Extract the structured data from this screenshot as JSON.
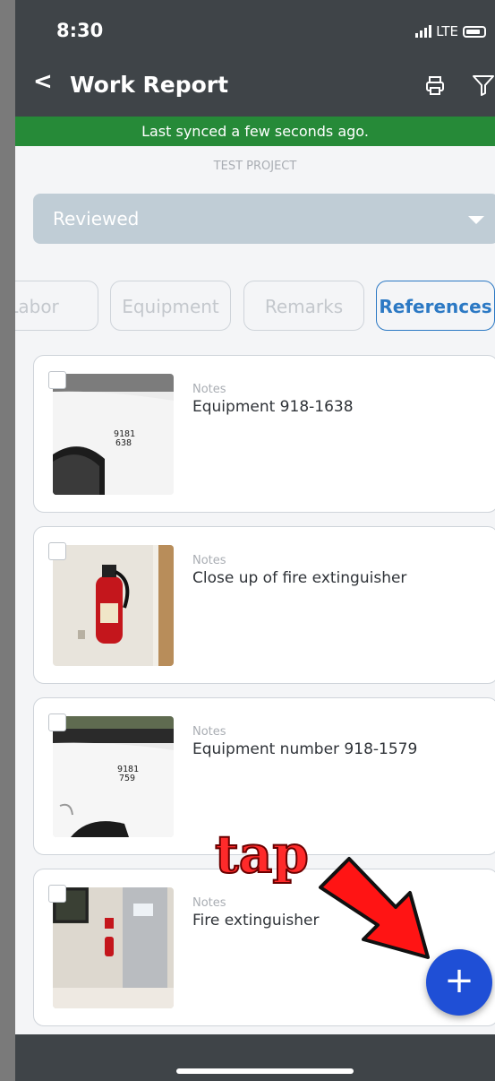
{
  "status_bar": {
    "time": "8:30",
    "network": "LTE"
  },
  "header": {
    "title": "Work Report",
    "back_glyph": "<"
  },
  "sync": {
    "message": "Last synced a few seconds ago."
  },
  "project": {
    "name": "TEST PROJECT"
  },
  "status_select": {
    "value": "Reviewed"
  },
  "tabs": [
    {
      "label": "Labor"
    },
    {
      "label": "Equipment"
    },
    {
      "label": "Remarks"
    },
    {
      "label": "References",
      "active": true
    }
  ],
  "references": [
    {
      "notes_label": "Notes",
      "note": "Equipment 918-1638",
      "photo_text": "9181\n638"
    },
    {
      "notes_label": "Notes",
      "note": "Close up of fire extinguisher"
    },
    {
      "notes_label": "Notes",
      "note": "Equipment number 918-1579",
      "photo_text": "9181\n759"
    },
    {
      "notes_label": "Notes",
      "note": "Fire extinguisher"
    }
  ],
  "fab": {
    "label": "+"
  },
  "annotation": {
    "text": "tap"
  },
  "colors": {
    "accent": "#2c79c4",
    "sync_green": "#268a38",
    "fab_blue": "#1f4fd6",
    "header_dark": "#3f4448"
  }
}
